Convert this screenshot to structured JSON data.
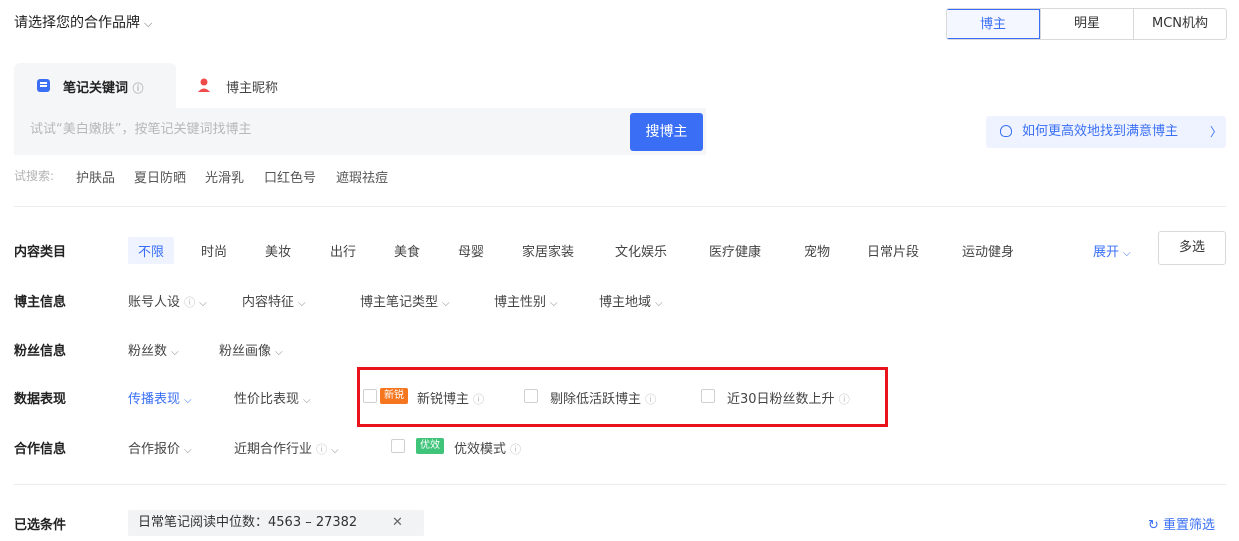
{
  "header": {
    "brand_select": "请选择您的合作品牌",
    "segments": [
      "博主",
      "明星",
      "MCN机构"
    ],
    "active_segment": "博主"
  },
  "search_tabs": {
    "tab1": "笔记关键词",
    "tab2": "博主昵称"
  },
  "search": {
    "placeholder": "试试“美白嫩肤”，按笔记关键词找博主",
    "button": "搜博主"
  },
  "help_link": "如何更高效地找到满意博主",
  "try_search": {
    "label": "试搜索:",
    "items": [
      "护肤品",
      "夏日防晒",
      "光滑乳",
      "口红色号",
      "遮瑕祛痘"
    ]
  },
  "filters": {
    "content_category": {
      "label": "内容类目",
      "options": [
        "不限",
        "时尚",
        "美妆",
        "出行",
        "美食",
        "母婴",
        "家居家装",
        "文化娱乐",
        "医疗健康",
        "宠物",
        "日常片段",
        "运动健身"
      ],
      "expand": "展开",
      "multi": "多选"
    },
    "blogger_info": {
      "label": "博主信息",
      "options": [
        "账号人设",
        "内容特征",
        "博主笔记类型",
        "博主性别",
        "博主地域"
      ]
    },
    "fan_info": {
      "label": "粉丝信息",
      "options": [
        "粉丝数",
        "粉丝画像"
      ]
    },
    "data_perf": {
      "label": "数据表现",
      "options": [
        "传播表现",
        "性价比表现"
      ],
      "new_tag": "新锐",
      "checkboxes": [
        "新锐博主",
        "剔除低活跃博主",
        "近30日粉丝数上升"
      ]
    },
    "coop_info": {
      "label": "合作信息",
      "options": [
        "合作报价",
        "近期合作行业"
      ],
      "tag": "优效",
      "checkbox": "优效模式"
    }
  },
  "selected": {
    "label": "已选条件",
    "chip": "日常笔记阅读中位数：4563 – 27382",
    "reset": "重置筛选"
  },
  "colors": {
    "accent": "#3a6ff5",
    "highlight": "#e8131b",
    "new_tag": "#f5761f",
    "effective_tag": "#3fc47a"
  }
}
